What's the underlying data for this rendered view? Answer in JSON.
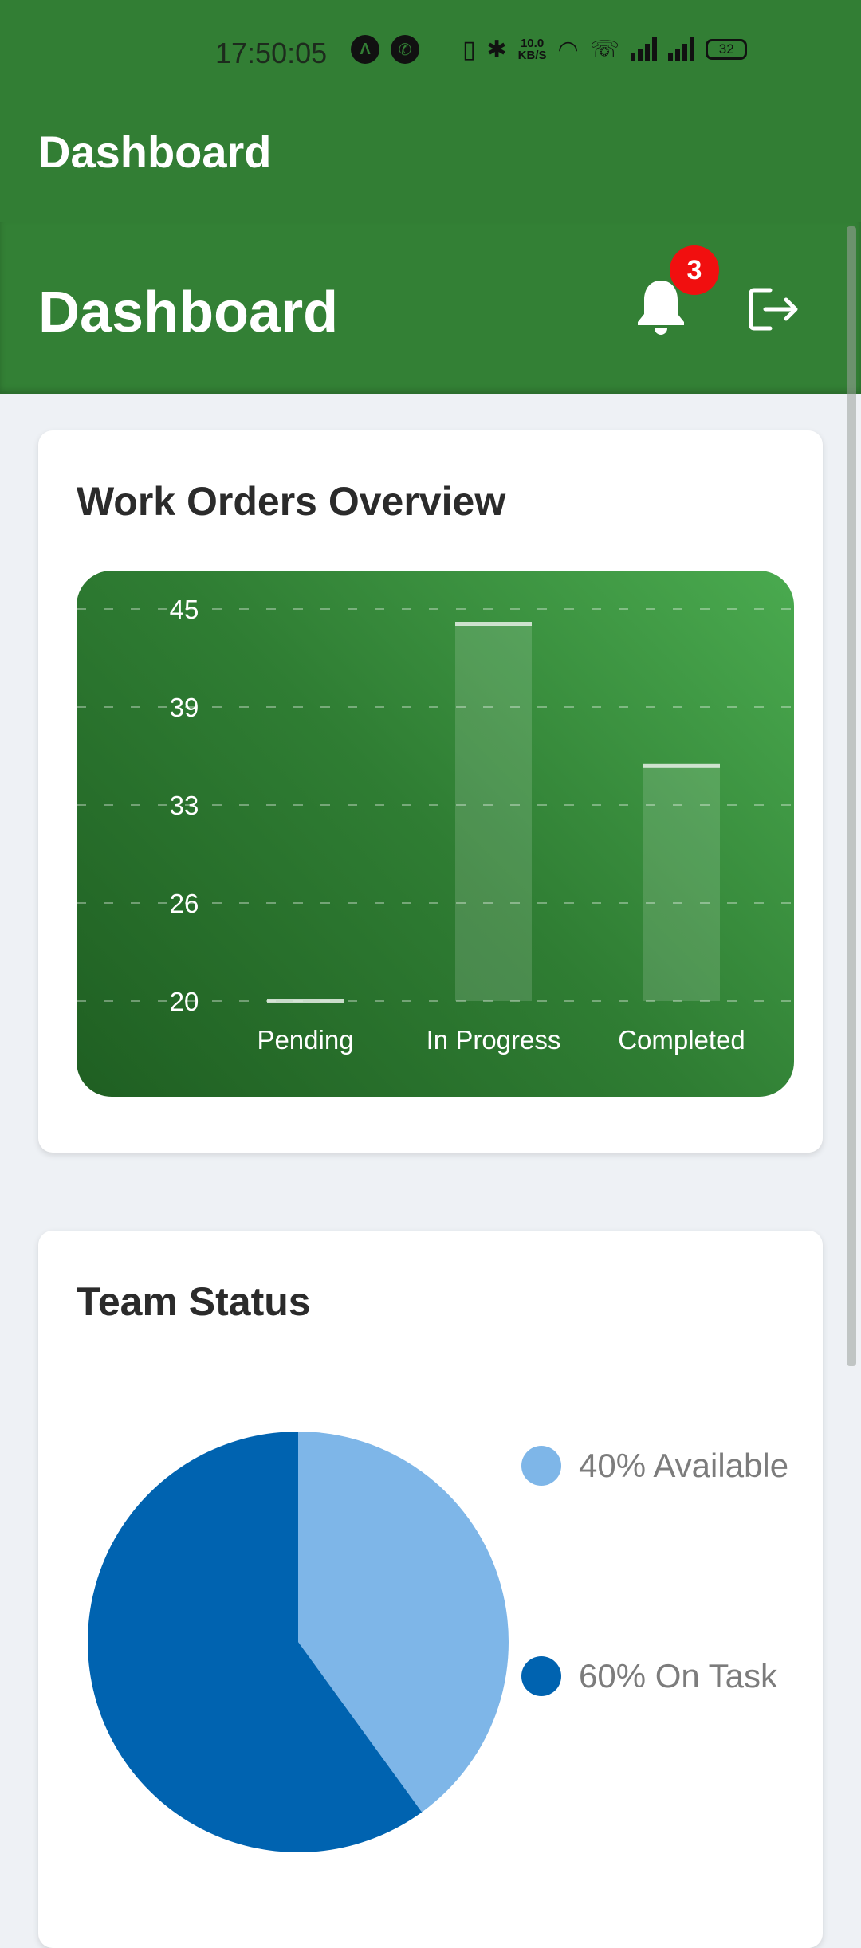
{
  "status_bar": {
    "time": "17:50:05",
    "speed_value": "10.0",
    "speed_unit": "KB/S",
    "battery": "32"
  },
  "app_bar": {
    "title": "Dashboard"
  },
  "header": {
    "title": "Dashboard",
    "notification_count": "3"
  },
  "work_orders": {
    "title": "Work Orders Overview"
  },
  "chart_data": [
    {
      "type": "bar",
      "title": "Work Orders Overview",
      "categories": [
        "Pending",
        "In Progress",
        "Completed"
      ],
      "values": [
        20,
        44,
        35
      ],
      "ylim": [
        20,
        45
      ],
      "yticks": [
        "45",
        "39",
        "33",
        "26",
        "20"
      ],
      "grid": true,
      "xlabel": "",
      "ylabel": ""
    },
    {
      "type": "pie",
      "title": "Team Status",
      "categories": [
        "Available",
        "On Task"
      ],
      "values": [
        40,
        60
      ],
      "colors": [
        "#7eb6e8",
        "#0063b0"
      ],
      "legend_position": "right"
    }
  ],
  "team_status": {
    "title": "Team Status",
    "legend": [
      {
        "label": "40% Available",
        "color": "#7eb6e8"
      },
      {
        "label": "60% On Task",
        "color": "#0063b0"
      }
    ]
  },
  "colors": {
    "primary_green": "#327e34",
    "badge_red": "#f10f0f",
    "background": "#eef1f5"
  }
}
